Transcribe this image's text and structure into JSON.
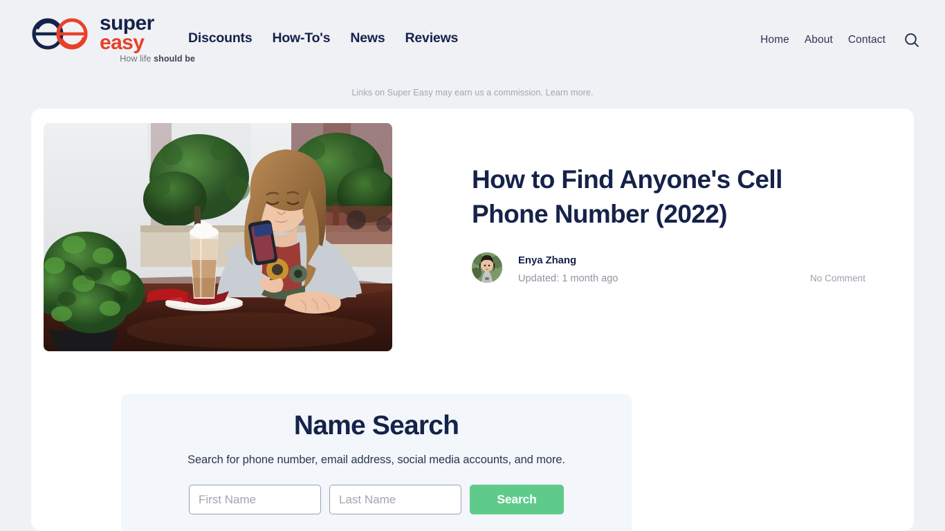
{
  "brand": {
    "name_line1": "super",
    "name_line2": "easy",
    "tagline_light": "How life ",
    "tagline_bold": "should be",
    "logo_icon": "double-e-circles-logo",
    "navy": "#15224a",
    "red": "#e8402a"
  },
  "nav": {
    "primary": [
      {
        "label": "Discounts"
      },
      {
        "label": "How-To's"
      },
      {
        "label": "News"
      },
      {
        "label": "Reviews"
      }
    ],
    "secondary": [
      {
        "label": "Home"
      },
      {
        "label": "About"
      },
      {
        "label": "Contact"
      }
    ],
    "search_icon": "search-icon"
  },
  "disclaimer": {
    "text": "Links on Super Easy may earn us a commission. Learn more."
  },
  "article": {
    "title": "How to Find Anyone's Cell Phone Number (2022)",
    "hero_alt": "woman-at-cafe-using-smartphone-with-latte",
    "author": {
      "name": "Enya Zhang",
      "avatar_alt": "author-portrait",
      "updated": "Updated: 1 month ago"
    },
    "comments": "No Comment"
  },
  "name_search": {
    "title": "Name Search",
    "subtitle": "Search for phone number, email address, social media accounts, and more.",
    "first_name_placeholder": "First Name",
    "first_name_value": "",
    "last_name_placeholder": "Last Name",
    "last_name_value": "",
    "submit_label": "Search",
    "submit_color": "#5ecb8a",
    "panel_color": "#f3f6fa"
  },
  "page": {
    "background": "#f0f1f5",
    "card_background": "#ffffff"
  }
}
